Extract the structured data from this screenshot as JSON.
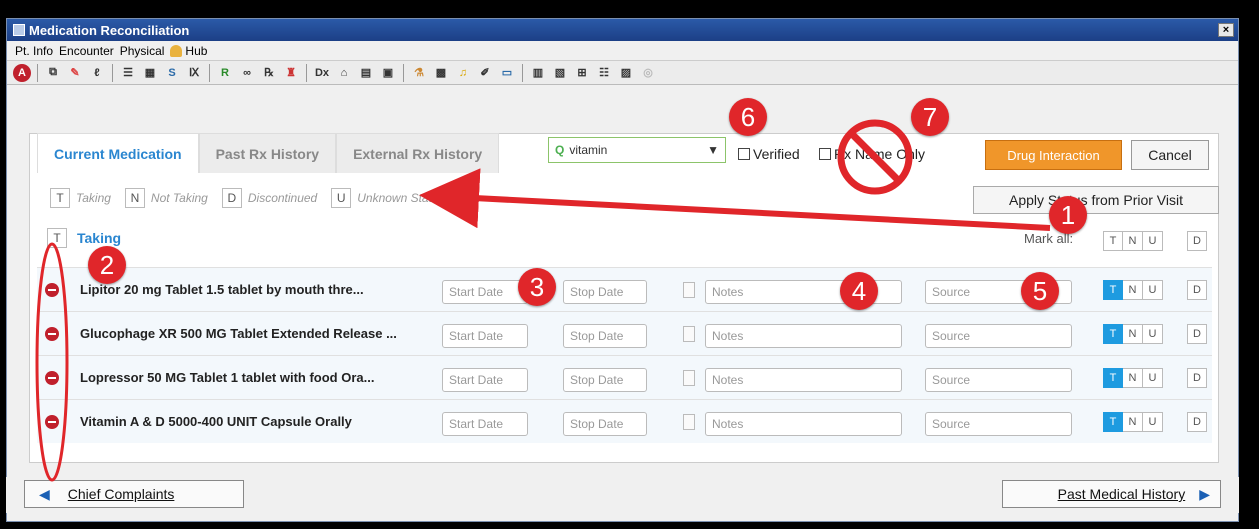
{
  "window": {
    "title": "Medication Reconciliation",
    "close": "×"
  },
  "menu": [
    "Pt. Info",
    "Encounter",
    "Physical",
    "Hub"
  ],
  "tabs": [
    "Current Medication",
    "Past Rx History",
    "External Rx History"
  ],
  "search": {
    "value": "vitamin"
  },
  "checkboxes": {
    "verified": "Verified",
    "rx_name_only": "Rx Name Only"
  },
  "buttons": {
    "drug_interaction": "Drug Interaction",
    "cancel": "Cancel",
    "apply_status": "Apply Status from Prior Visit"
  },
  "legend": [
    {
      "key": "T",
      "label": "Taking"
    },
    {
      "key": "N",
      "label": "Not Taking"
    },
    {
      "key": "D",
      "label": "Discontinued"
    },
    {
      "key": "U",
      "label": "Unknown Status"
    }
  ],
  "group": {
    "key": "T",
    "label": "Taking",
    "mark_all": "Mark all:"
  },
  "status_keys": {
    "t": "T",
    "n": "N",
    "u": "U",
    "d": "D"
  },
  "placeholders": {
    "start": "Start Date",
    "stop": "Stop Date",
    "notes": "Notes",
    "source": "Source"
  },
  "medications": [
    "Lipitor 20 mg Tablet 1.5 tablet by mouth thre...",
    "Glucophage XR 500 MG Tablet Extended Release ...",
    "Lopressor 50 MG Tablet 1 tablet with food Ora...",
    "Vitamin A & D 5000-400 UNIT Capsule Orally"
  ],
  "footer": {
    "left": "Chief Complaints",
    "right": "Past Medical History"
  },
  "annotations": [
    "1",
    "2",
    "3",
    "4",
    "5",
    "6",
    "7"
  ],
  "colors": {
    "accent": "#2a86d0",
    "drug_btn": "#f0962a",
    "annotation_red": "#e0262a",
    "taking_on": "#1e9be0"
  }
}
